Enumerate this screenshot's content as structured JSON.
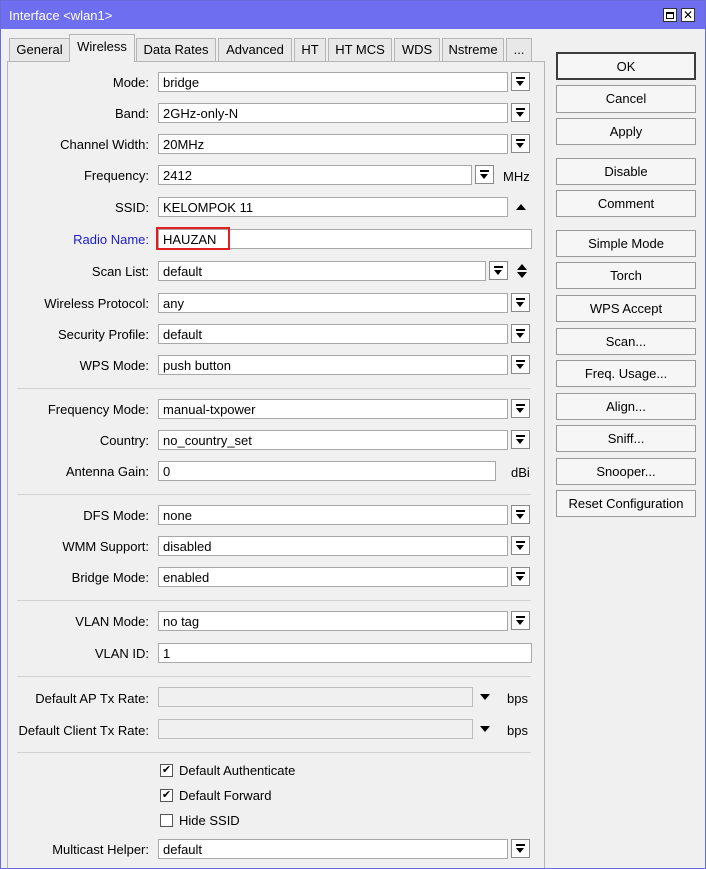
{
  "window": {
    "title": "Interface <wlan1>"
  },
  "tabs": [
    "General",
    "Wireless",
    "Data Rates",
    "Advanced",
    "HT",
    "HT MCS",
    "WDS",
    "Nstreme",
    "..."
  ],
  "form": {
    "mode": {
      "label": "Mode:",
      "value": "bridge"
    },
    "band": {
      "label": "Band:",
      "value": "2GHz-only-N"
    },
    "channel_width": {
      "label": "Channel Width:",
      "value": "20MHz"
    },
    "frequency": {
      "label": "Frequency:",
      "value": "2412",
      "unit": "MHz"
    },
    "ssid": {
      "label": "SSID:",
      "value": "KELOMPOK 11"
    },
    "radio_name": {
      "label": "Radio Name:",
      "value": "HAUZAN"
    },
    "scan_list": {
      "label": "Scan List:",
      "value": "default"
    },
    "wireless_protocol": {
      "label": "Wireless Protocol:",
      "value": "any"
    },
    "security_profile": {
      "label": "Security Profile:",
      "value": "default"
    },
    "wps_mode": {
      "label": "WPS Mode:",
      "value": "push button"
    },
    "frequency_mode": {
      "label": "Frequency Mode:",
      "value": "manual-txpower"
    },
    "country": {
      "label": "Country:",
      "value": "no_country_set"
    },
    "antenna_gain": {
      "label": "Antenna Gain:",
      "value": "0",
      "unit": "dBi"
    },
    "dfs_mode": {
      "label": "DFS Mode:",
      "value": "none"
    },
    "wmm_support": {
      "label": "WMM Support:",
      "value": "disabled"
    },
    "bridge_mode": {
      "label": "Bridge Mode:",
      "value": "enabled"
    },
    "vlan_mode": {
      "label": "VLAN Mode:",
      "value": "no tag"
    },
    "vlan_id": {
      "label": "VLAN ID:",
      "value": "1"
    },
    "default_ap_tx_rate": {
      "label": "Default AP Tx Rate:",
      "value": "",
      "unit": "bps"
    },
    "default_client_tx_rate": {
      "label": "Default Client Tx Rate:",
      "value": "",
      "unit": "bps"
    },
    "default_authenticate": {
      "label": "Default Authenticate",
      "checked": true
    },
    "default_forward": {
      "label": "Default Forward",
      "checked": true
    },
    "hide_ssid": {
      "label": "Hide SSID",
      "checked": false
    },
    "multicast_helper": {
      "label": "Multicast Helper:",
      "value": "default"
    }
  },
  "checkmark": "✔",
  "buttons": [
    "OK",
    "Cancel",
    "Apply",
    "Disable",
    "Comment",
    "Simple Mode",
    "Torch",
    "WPS Accept",
    "Scan...",
    "Freq. Usage...",
    "Align...",
    "Sniff...",
    "Snooper...",
    "Reset Configuration"
  ],
  "colors": {
    "titlebar": "#6e6ef0",
    "radio_name_label": "#1c1cd0",
    "highlight_box": "#e02020"
  }
}
